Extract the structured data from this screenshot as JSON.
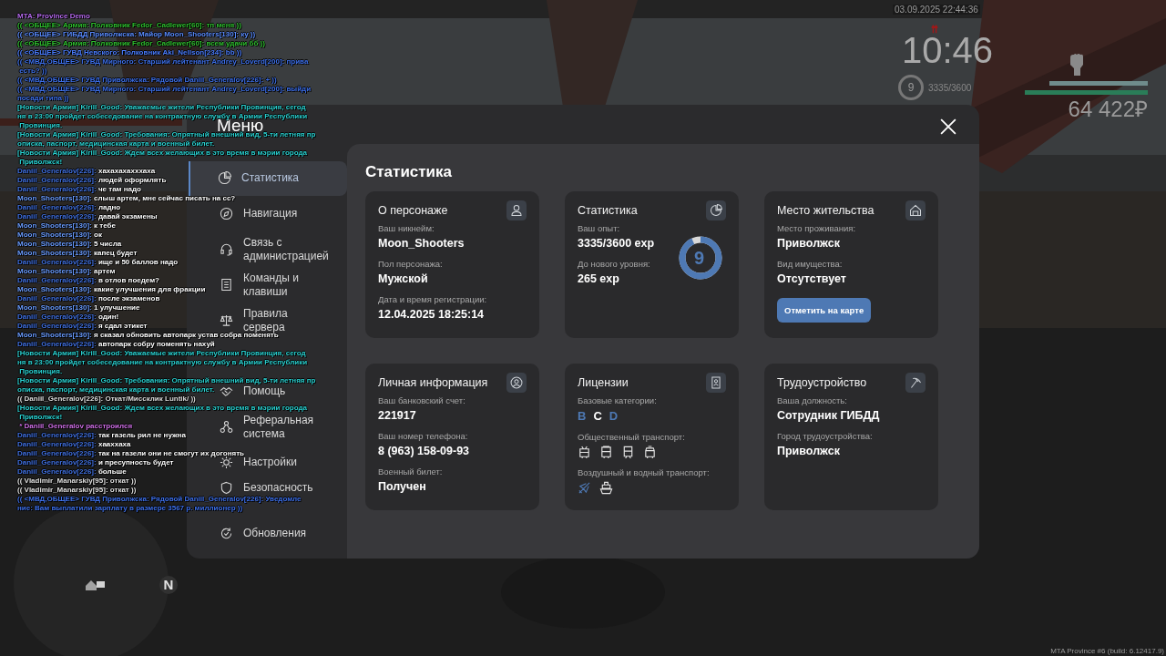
{
  "chat": [
    {
      "text": "MTA: Province Demo",
      "color": "#b86cf0"
    },
    {
      "text": "(( <ОБЩЕЕ> Армия: Полковник Fedor_Cadlewer[60]: тп меня ))",
      "color": "#2fc02f"
    },
    {
      "text": "(( <ОБЩЕЕ> ГИБДД Приволжска: Майор Moon_Shooters[130]: ку ))",
      "color": "#5a8cff"
    },
    {
      "text": "(( <ОБЩЕЕ> Армия: Полковник Fedor_Cadlewer[60]: всем удачи бб ))",
      "color": "#2fc02f"
    },
    {
      "text": "(( <ОБЩЕЕ> ГУВД Невского: Полковник Aki_Nellson[234]: bb ))",
      "color": "#4a7dff"
    },
    {
      "text": "(( <МВД,ОБЩЕЕ> ГУВД Мирного: Старший лейтенант Andrey_Loverd[200]: прива",
      "color": "#3d6fe8"
    },
    {
      "text": " есть? ))",
      "color": "#3d6fe8"
    },
    {
      "text": "(( <МВД,ОБЩЕЕ> ГУВД Приволжска: Рядовой Daniil_Generalov[226]: + ))",
      "color": "#3d6fe8"
    },
    {
      "text": "(( <МВД,ОБЩЕЕ> ГУВД Мирного: Старший лейтенант Andrey_Loverd[200]: выйди",
      "color": "#3d6fe8"
    },
    {
      "text": "посади типа ))",
      "color": "#3d6fe8"
    },
    {
      "text": "[Новости Армия] Kirill_Good: Уважаемые жители Республики Провинция, сегод",
      "color": "#2ad0d0"
    },
    {
      "text": "ня в 23:00 пройдет собеседование на контрактную службу в Армии Республики",
      "color": "#2ad0d0"
    },
    {
      "text": " Провинция.",
      "color": "#2ad0d0"
    },
    {
      "text": "[Новости Армия] Kirill_Good: Требования: Опрятный внешний вид, 5-ти летняя пр",
      "color": "#2ad0d0"
    },
    {
      "text": "описка, паспорт, медицинская карта и военный билет.",
      "color": "#2ad0d0"
    },
    {
      "text": "[Новости Армия] Kirill_Good: Ждем всех желающих в это время в мэрии города",
      "color": "#2ad0d0"
    },
    {
      "text": " Приволжск!",
      "color": "#2ad0d0"
    },
    {
      "name": "Daniil_Generalov[226]:",
      "text": "хахахахахххаха",
      "color": "#4070e0"
    },
    {
      "name": "Daniil_Generalov[226]:",
      "text": "людей оформлять",
      "color": "#4070e0"
    },
    {
      "name": "Daniil_Generalov[226]:",
      "text": "че там надо",
      "color": "#4070e0"
    },
    {
      "name": "Moon_Shooters[130]:",
      "text": "слыш артем, мне сейчас писать на сс?",
      "color": "#6a9cff"
    },
    {
      "name": "Daniil_Generalov[226]:",
      "text": "ладно",
      "color": "#4070e0"
    },
    {
      "name": "Daniil_Generalov[226]:",
      "text": "давай экзамены",
      "color": "#4070e0"
    },
    {
      "name": "Moon_Shooters[130]:",
      "text": "к тебе",
      "color": "#6a9cff"
    },
    {
      "name": "Moon_Shooters[130]:",
      "text": "ок",
      "color": "#6a9cff"
    },
    {
      "name": "Moon_Shooters[130]:",
      "text": "5 числа",
      "color": "#6a9cff"
    },
    {
      "name": "Moon_Shooters[130]:",
      "text": "капец будет",
      "color": "#6a9cff"
    },
    {
      "name": "Daniil_Generalov[226]:",
      "text": "ище и 50 баллов надо",
      "color": "#4070e0"
    },
    {
      "name": "Moon_Shooters[130]:",
      "text": "артем",
      "color": "#6a9cff"
    },
    {
      "name": "Daniil_Generalov[226]:",
      "text": "в отлов поедем?",
      "color": "#4070e0"
    },
    {
      "name": "Moon_Shooters[130]:",
      "text": "какие улучшения для фракции",
      "color": "#6a9cff"
    },
    {
      "name": "Daniil_Generalov[226]:",
      "text": "после экзаменов",
      "color": "#4070e0"
    },
    {
      "name": "Moon_Shooters[130]:",
      "text": "1 улучшение",
      "color": "#6a9cff"
    },
    {
      "name": "Daniil_Generalov[226]:",
      "text": "один!",
      "color": "#4070e0"
    },
    {
      "name": "Daniil_Generalov[226]:",
      "text": "я сдал этикет",
      "color": "#4070e0"
    },
    {
      "name": "Moon_Shooters[130]:",
      "text": "я сказал обновить автопарк устав собра поменять",
      "color": "#6a9cff"
    },
    {
      "name": "Daniil_Generalov[226]:",
      "text": "автопарк собру поменять нахуй",
      "color": "#4070e0"
    },
    {
      "text": "[Новости Армия] Kirill_Good: Уважаемые жители Республики Провинция, сегод",
      "color": "#2ad0d0"
    },
    {
      "text": "ня в 23:00 пройдет собеседование на контрактную службу в Армии Республики",
      "color": "#2ad0d0"
    },
    {
      "text": " Провинция.",
      "color": "#2ad0d0"
    },
    {
      "text": "[Новости Армия] Kirill_Good: Требования: Опрятный внешний вид, 5-ти летняя пр",
      "color": "#2ad0d0"
    },
    {
      "text": "описка, паспорт, медицинская карта и военный билет.",
      "color": "#2ad0d0"
    },
    {
      "text": "(( Daniil_Generalov[226]: Откат/Миссклик Luntik/ ))",
      "color": "#dddddd"
    },
    {
      "text": "[Новости Армия] Kirill_Good: Ждем всех желающих в это время в мэрии города",
      "color": "#2ad0d0"
    },
    {
      "text": " Приволжск!",
      "color": "#2ad0d0"
    },
    {
      "text": " * Daniil_Generalov расстроился",
      "color": "#d070e8"
    },
    {
      "name": "Daniil_Generalov[226]:",
      "text": "так газель рил не нужна",
      "color": "#4070e0"
    },
    {
      "name": "Daniil_Generalov[226]:",
      "text": "хааххаха",
      "color": "#4070e0"
    },
    {
      "name": "Daniil_Generalov[226]:",
      "text": "так на газели они не смогут их догонять",
      "color": "#4070e0"
    },
    {
      "name": "Daniil_Generalov[226]:",
      "text": "и пресупность будет",
      "color": "#4070e0"
    },
    {
      "name": "Daniil_Generalov[226]:",
      "text": "больше",
      "color": "#4070e0"
    },
    {
      "text": "(( Vladimir_Manarskiy[95]: откат ))",
      "color": "#e0e0e0"
    },
    {
      "text": "(( Vladimir_Manarskiy[95]: откат ))",
      "color": "#e0e0e0"
    },
    {
      "text": "(( <МВД,ОБЩЕЕ> ГУВД Приволжска: Рядовой Daniil_Generalov[226]: Уведомле",
      "color": "#3d6fe8"
    },
    {
      "text": "ние: Вам выплатили зарплату в размере 3567 р. миллионер ))",
      "color": "#3d6fe8"
    }
  ],
  "hud": {
    "datetime": "03.09.2025 22:44:36",
    "time": "10:46",
    "level": "9",
    "experience": "3335/3600",
    "health": {
      "level": 1
    },
    "armor": {
      "level": 1
    },
    "money": "64 422₽"
  },
  "minimap": {
    "north": "N"
  },
  "menu": {
    "title": "Меню",
    "nav": [
      {
        "label": "Статистика",
        "selected": true
      },
      {
        "label": "Навигация",
        "selected": false
      },
      {
        "label": "Связь с администрацией",
        "selected": false
      },
      {
        "label": "Команды и клавиши",
        "selected": false
      },
      {
        "label": "Правила сервера",
        "selected": false
      },
      {
        "label": "Помощь",
        "selected": false
      },
      {
        "label": "Реферальная система",
        "selected": false
      },
      {
        "label": "Настройки",
        "selected": false
      },
      {
        "label": "Безопасность",
        "selected": false
      },
      {
        "label": "Обновления",
        "selected": false
      }
    ],
    "heading": "Статистика",
    "cards": [
      {
        "kind": "fields",
        "title": "О персонаже",
        "fields": [
          {
            "label": "Ваш никнейм:",
            "value": "Moon_Shooters"
          },
          {
            "label": "Пол персонажа:",
            "value": "Мужской"
          },
          {
            "label": "Дата и время регистрации:",
            "value": "12.04.2025 18:25:14"
          }
        ]
      },
      {
        "kind": "stats",
        "title": "Статистика",
        "fields": [
          {
            "label": "Ваш опыт:",
            "value": "3335/3600 exp"
          },
          {
            "label": "До нового уровня:",
            "value": "265 exp"
          }
        ],
        "ring": {
          "text": "9",
          "level": 0.926
        }
      },
      {
        "kind": "fields",
        "title": "Место жительства",
        "fields": [
          {
            "label": "Место проживания:",
            "value": "Приволжск"
          },
          {
            "label": "Вид имущества:",
            "value": "Отсутствует"
          }
        ],
        "button": "Отметить на карте"
      },
      {
        "kind": "fields",
        "title": "Личная информация",
        "fields": [
          {
            "label": "Ваш банковский счет:",
            "value": "221917"
          },
          {
            "label": "Ваш номер телефона:",
            "value": "8 (963) 158-09-93"
          },
          {
            "label": "Военный билет:",
            "value": "Получен"
          }
        ]
      },
      {
        "kind": "licenses",
        "title": "Лицензии",
        "categories": {
          "label": "Базовые категории:",
          "items": [
            {
              "letter": "B",
              "held": true
            },
            {
              "letter": "C",
              "held": false
            },
            {
              "letter": "D",
              "held": true
            }
          ]
        },
        "public": {
          "label": "Общественный транспорт:",
          "items": [
            {
              "held": false
            },
            {
              "held": false
            },
            {
              "held": false
            },
            {
              "held": false
            }
          ]
        },
        "air_water": {
          "label": "Воздушный и водный транспорт:",
          "items": [
            {
              "held": true
            },
            {
              "held": false
            }
          ]
        }
      },
      {
        "kind": "fields",
        "title": "Трудоустройство",
        "fields": [
          {
            "label": "Ваша должность:",
            "value": "Сотрудник ГИБДД"
          },
          {
            "label": "Город трудоустройства:",
            "value": "Приволжск"
          }
        ]
      }
    ]
  },
  "build": "MTA Province #6 (build: 6.12417.9)"
}
